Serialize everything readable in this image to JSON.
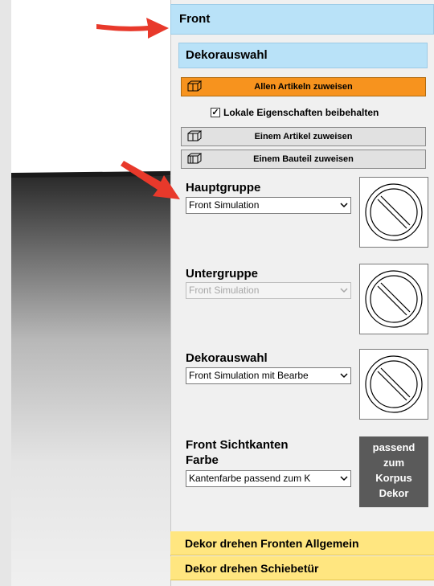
{
  "panel": {
    "front_title": "Front",
    "dekor_section_title": "Dekorauswahl",
    "assign_all_label": "Allen Artikeln zuweisen",
    "keep_local_label": "Lokale Eigenschaften beibehalten",
    "keep_local_checked": true,
    "assign_one_label": "Einem Artikel zuweisen",
    "assign_part_label": "Einem Bauteil zuweisen",
    "hauptgruppe": {
      "label": "Hauptgruppe",
      "value": "Front Simulation"
    },
    "untergruppe": {
      "label": "Untergruppe",
      "value": "Front Simulation"
    },
    "dekorauswahl": {
      "label": "Dekorauswahl",
      "value": "Front Simulation mit Bearbe"
    },
    "sichtkanten": {
      "label_line1": "Front Sichtkanten",
      "label_line2": "Farbe",
      "value": "Kantenfarbe passend zum K",
      "preview_line1": "passend",
      "preview_line2": "zum",
      "preview_line3": "Korpus",
      "preview_line4": "Dekor"
    },
    "dekor_drehen_allgemein": "Dekor drehen Fronten Allgemein",
    "dekor_drehen_schiebetuer": "Dekor drehen Schiebetür"
  },
  "colors": {
    "header_blue": "#b9e2f8",
    "primary_orange": "#f7931e",
    "accordion_yellow": "#ffe680",
    "annotation_red": "#e8392b"
  }
}
